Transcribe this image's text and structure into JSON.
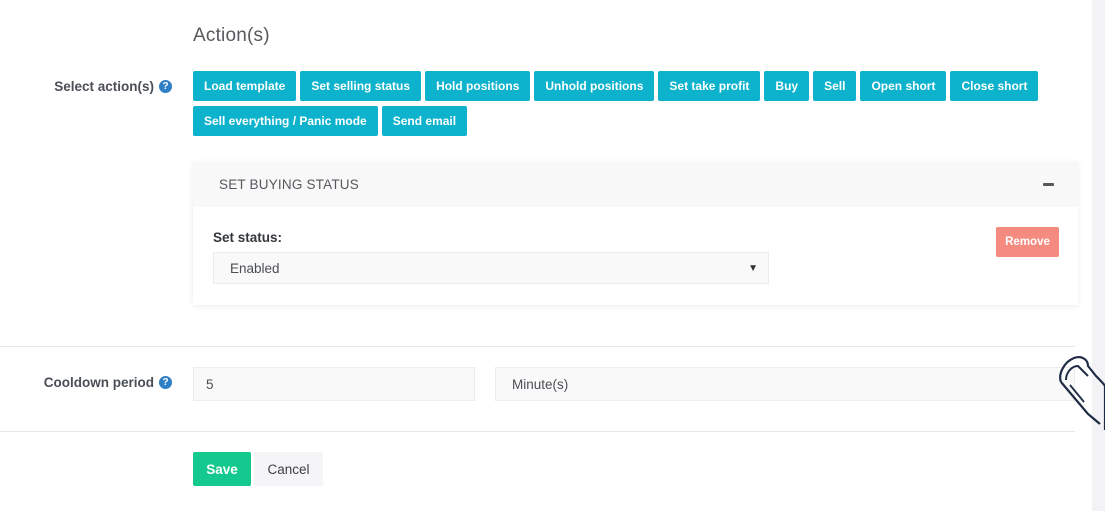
{
  "section_title": "Action(s)",
  "select_actions": {
    "label": "Select action(s)",
    "help_icon": "?",
    "rows": [
      [
        "Load template",
        "Set selling status",
        "Hold positions",
        "Unhold positions",
        "Set take profit",
        "Buy",
        "Sell",
        "Open short",
        "Close short"
      ],
      [
        "Sell everything / Panic mode",
        "Send email"
      ]
    ]
  },
  "action_panel": {
    "title": "SET BUYING STATUS",
    "status_label": "Set status:",
    "status_value": "Enabled",
    "remove_label": "Remove"
  },
  "cooldown": {
    "label": "Cooldown period",
    "help_icon": "?",
    "value": "5",
    "unit": "Minute(s)"
  },
  "footer": {
    "save_label": "Save",
    "cancel_label": "Cancel"
  },
  "colors": {
    "action_button": "#0db2cc",
    "remove_button": "#f58b80",
    "save_button": "#14c98e",
    "help_icon": "#2f7fc4"
  },
  "icons": [
    "question-circle-icon",
    "collapse-minus-icon",
    "caret-down-icon",
    "hand-pointer-cursor-icon"
  ]
}
